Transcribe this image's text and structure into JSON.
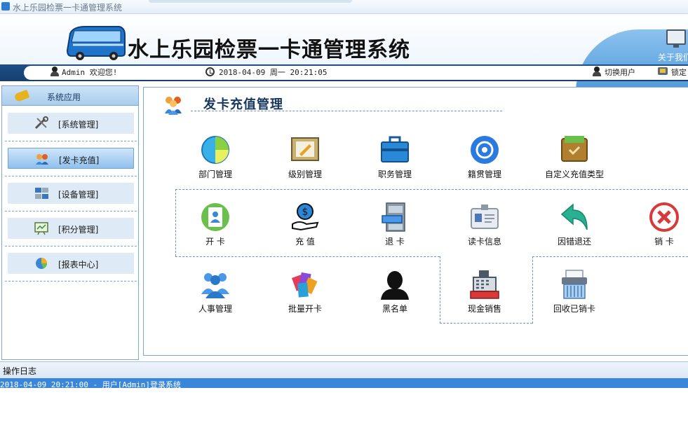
{
  "window": {
    "title": "水上乐园检票一卡通管理系统"
  },
  "header": {
    "system_title": "水上乐园检票一卡通管理系统",
    "about_label": "关于我们"
  },
  "statusbar": {
    "welcome": "Admin 欢迎您!",
    "datetime": "2018-04-09 周一 20:21:05",
    "switch_user": "切换用户",
    "lock": "锁定"
  },
  "sidebar": {
    "header": "系统应用",
    "items": [
      {
        "label": "[系统管理]",
        "icon": "tools-icon"
      },
      {
        "label": "[发卡充值]",
        "icon": "users-icon",
        "active": true
      },
      {
        "label": "[设备管理]",
        "icon": "devices-icon"
      },
      {
        "label": "[积分管理]",
        "icon": "points-board-icon"
      },
      {
        "label": "[报表中心]",
        "icon": "pie-chart-icon"
      }
    ]
  },
  "main": {
    "section_title": "发卡充值管理",
    "tiles": [
      {
        "label": "部门管理",
        "icon": "department-icon"
      },
      {
        "label": "级别管理",
        "icon": "level-icon"
      },
      {
        "label": "职务管理",
        "icon": "briefcase-icon"
      },
      {
        "label": "籍贯管理",
        "icon": "origin-icon"
      },
      {
        "label": "自定义充值类型",
        "icon": "custom-recharge-icon"
      },
      {
        "label": "开 卡",
        "icon": "open-card-icon"
      },
      {
        "label": "充 值",
        "icon": "recharge-icon"
      },
      {
        "label": "退 卡",
        "icon": "return-card-icon"
      },
      {
        "label": "读卡信息",
        "icon": "read-card-icon"
      },
      {
        "label": "因错退还",
        "icon": "refund-arrow-icon"
      },
      {
        "label": "销 卡",
        "icon": "cancel-card-icon"
      },
      {
        "label": "人事管理",
        "icon": "personnel-icon"
      },
      {
        "label": "批量开卡",
        "icon": "batch-card-icon"
      },
      {
        "label": "黑名单",
        "icon": "blacklist-icon"
      },
      {
        "label": "现金销售",
        "icon": "cash-register-icon"
      },
      {
        "label": "回收已销卡",
        "icon": "shredder-icon"
      }
    ]
  },
  "log": {
    "title": "操作日志",
    "entries": [
      "2018-04-09 20:21:00 - 用户[Admin]登录系统"
    ]
  },
  "colors": {
    "accent": "#15406f",
    "highlight": "#3a86d8",
    "border": "#7fa7d0"
  }
}
